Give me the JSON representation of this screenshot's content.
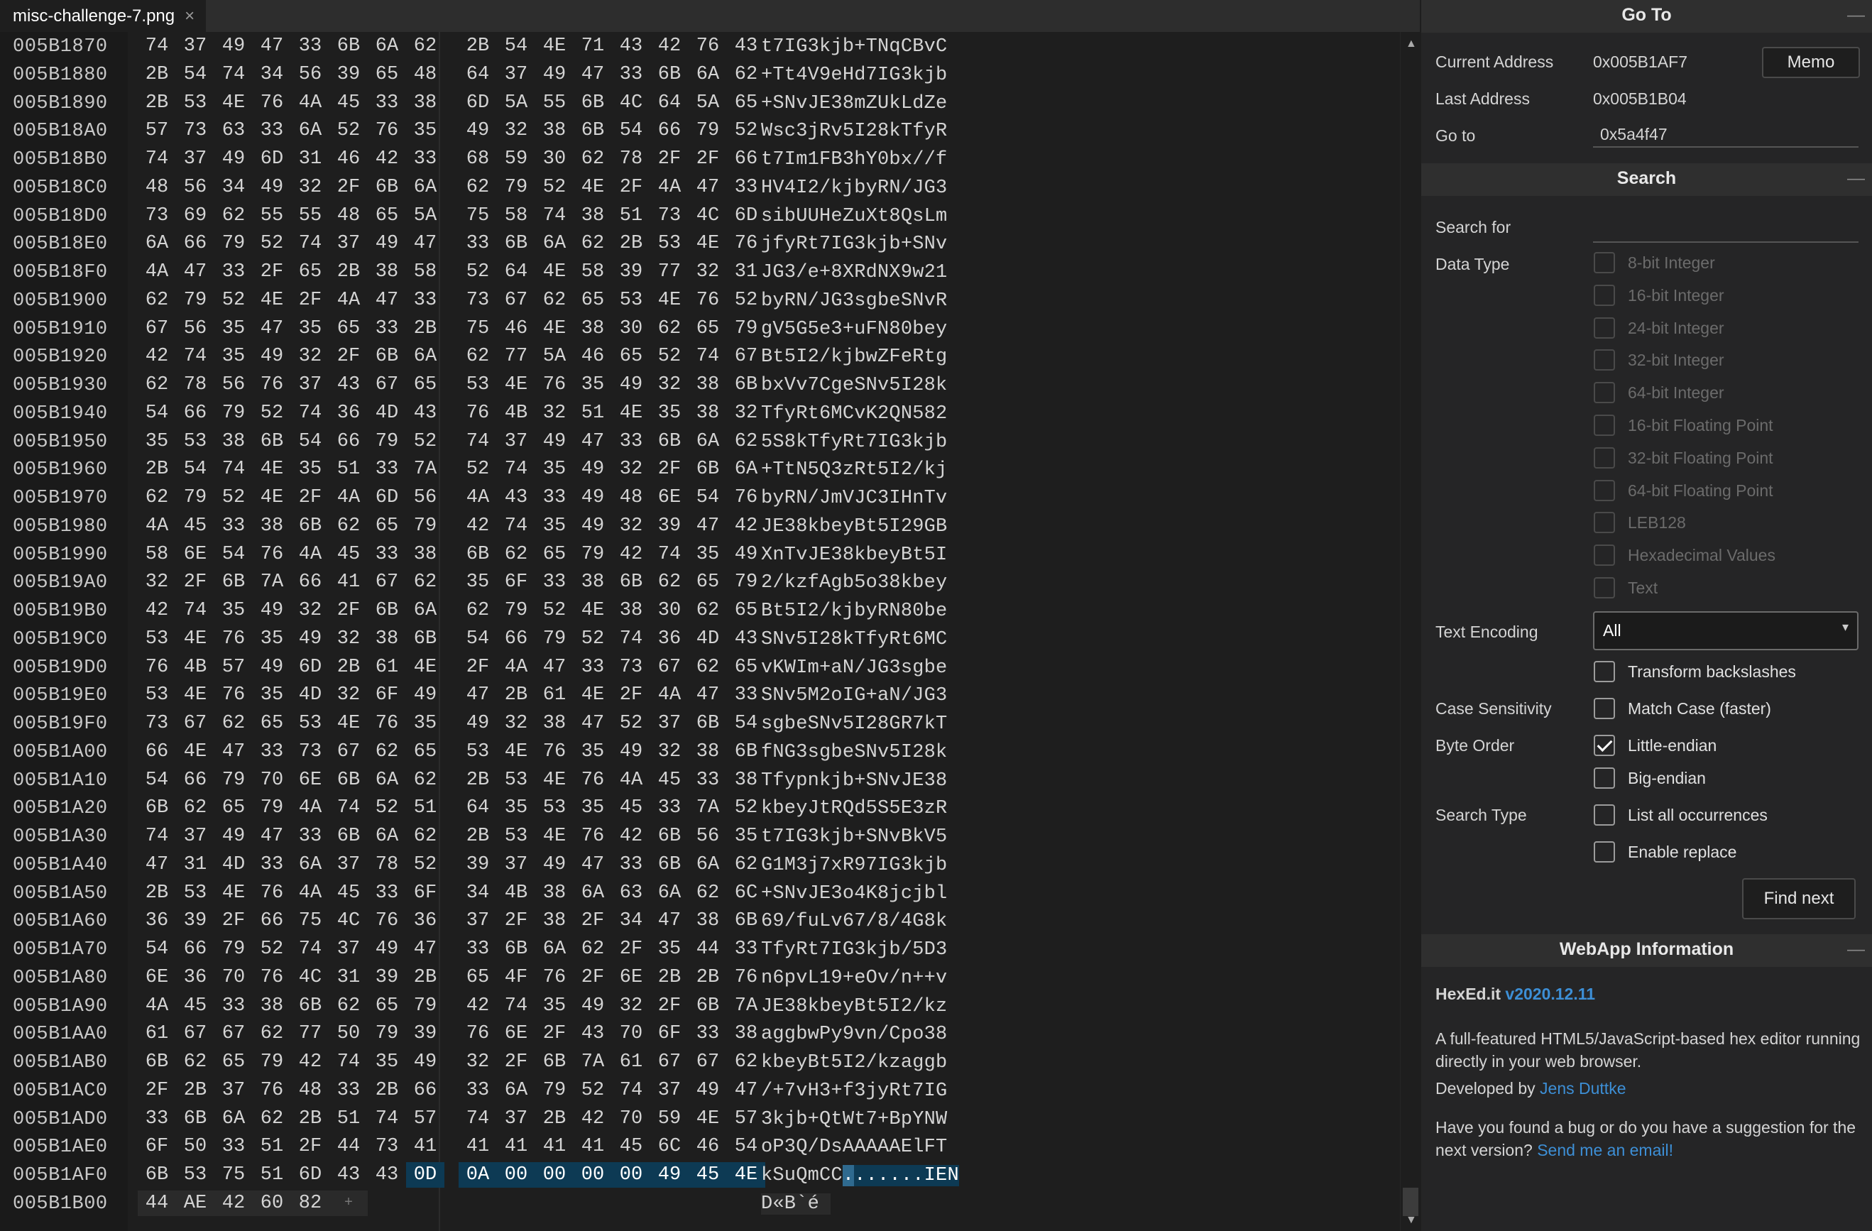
{
  "tab": {
    "title": "misc-challenge-7.png",
    "close": "×"
  },
  "editor": {
    "rows": [
      {
        "offset": "005B1870",
        "bytes": [
          "74",
          "37",
          "49",
          "47",
          "33",
          "6B",
          "6A",
          "62",
          "2B",
          "54",
          "4E",
          "71",
          "43",
          "42",
          "76",
          "43"
        ],
        "ascii": "t7IG3kjb+TNqCBvC"
      },
      {
        "offset": "005B1880",
        "bytes": [
          "2B",
          "54",
          "74",
          "34",
          "56",
          "39",
          "65",
          "48",
          "64",
          "37",
          "49",
          "47",
          "33",
          "6B",
          "6A",
          "62"
        ],
        "ascii": "+Tt4V9eHd7IG3kjb"
      },
      {
        "offset": "005B1890",
        "bytes": [
          "2B",
          "53",
          "4E",
          "76",
          "4A",
          "45",
          "33",
          "38",
          "6D",
          "5A",
          "55",
          "6B",
          "4C",
          "64",
          "5A",
          "65"
        ],
        "ascii": "+SNvJE38mZUkLdZe"
      },
      {
        "offset": "005B18A0",
        "bytes": [
          "57",
          "73",
          "63",
          "33",
          "6A",
          "52",
          "76",
          "35",
          "49",
          "32",
          "38",
          "6B",
          "54",
          "66",
          "79",
          "52"
        ],
        "ascii": "Wsc3jRv5I28kTfyR"
      },
      {
        "offset": "005B18B0",
        "bytes": [
          "74",
          "37",
          "49",
          "6D",
          "31",
          "46",
          "42",
          "33",
          "68",
          "59",
          "30",
          "62",
          "78",
          "2F",
          "2F",
          "66"
        ],
        "ascii": "t7Im1FB3hY0bx//f"
      },
      {
        "offset": "005B18C0",
        "bytes": [
          "48",
          "56",
          "34",
          "49",
          "32",
          "2F",
          "6B",
          "6A",
          "62",
          "79",
          "52",
          "4E",
          "2F",
          "4A",
          "47",
          "33"
        ],
        "ascii": "HV4I2/kjbyRN/JG3"
      },
      {
        "offset": "005B18D0",
        "bytes": [
          "73",
          "69",
          "62",
          "55",
          "55",
          "48",
          "65",
          "5A",
          "75",
          "58",
          "74",
          "38",
          "51",
          "73",
          "4C",
          "6D"
        ],
        "ascii": "sibUUHeZuXt8QsLm"
      },
      {
        "offset": "005B18E0",
        "bytes": [
          "6A",
          "66",
          "79",
          "52",
          "74",
          "37",
          "49",
          "47",
          "33",
          "6B",
          "6A",
          "62",
          "2B",
          "53",
          "4E",
          "76"
        ],
        "ascii": "jfyRt7IG3kjb+SNv"
      },
      {
        "offset": "005B18F0",
        "bytes": [
          "4A",
          "47",
          "33",
          "2F",
          "65",
          "2B",
          "38",
          "58",
          "52",
          "64",
          "4E",
          "58",
          "39",
          "77",
          "32",
          "31"
        ],
        "ascii": "JG3/e+8XRdNX9w21"
      },
      {
        "offset": "005B1900",
        "bytes": [
          "62",
          "79",
          "52",
          "4E",
          "2F",
          "4A",
          "47",
          "33",
          "73",
          "67",
          "62",
          "65",
          "53",
          "4E",
          "76",
          "52"
        ],
        "ascii": "byRN/JG3sgbeSNvR"
      },
      {
        "offset": "005B1910",
        "bytes": [
          "67",
          "56",
          "35",
          "47",
          "35",
          "65",
          "33",
          "2B",
          "75",
          "46",
          "4E",
          "38",
          "30",
          "62",
          "65",
          "79"
        ],
        "ascii": "gV5G5e3+uFN80bey"
      },
      {
        "offset": "005B1920",
        "bytes": [
          "42",
          "74",
          "35",
          "49",
          "32",
          "2F",
          "6B",
          "6A",
          "62",
          "77",
          "5A",
          "46",
          "65",
          "52",
          "74",
          "67"
        ],
        "ascii": "Bt5I2/kjbwZFeRtg"
      },
      {
        "offset": "005B1930",
        "bytes": [
          "62",
          "78",
          "56",
          "76",
          "37",
          "43",
          "67",
          "65",
          "53",
          "4E",
          "76",
          "35",
          "49",
          "32",
          "38",
          "6B"
        ],
        "ascii": "bxVv7CgeSNv5I28k"
      },
      {
        "offset": "005B1940",
        "bytes": [
          "54",
          "66",
          "79",
          "52",
          "74",
          "36",
          "4D",
          "43",
          "76",
          "4B",
          "32",
          "51",
          "4E",
          "35",
          "38",
          "32"
        ],
        "ascii": "TfyRt6MCvK2QN582"
      },
      {
        "offset": "005B1950",
        "bytes": [
          "35",
          "53",
          "38",
          "6B",
          "54",
          "66",
          "79",
          "52",
          "74",
          "37",
          "49",
          "47",
          "33",
          "6B",
          "6A",
          "62"
        ],
        "ascii": "5S8kTfyRt7IG3kjb"
      },
      {
        "offset": "005B1960",
        "bytes": [
          "2B",
          "54",
          "74",
          "4E",
          "35",
          "51",
          "33",
          "7A",
          "52",
          "74",
          "35",
          "49",
          "32",
          "2F",
          "6B",
          "6A"
        ],
        "ascii": "+TtN5Q3zRt5I2/kj"
      },
      {
        "offset": "005B1970",
        "bytes": [
          "62",
          "79",
          "52",
          "4E",
          "2F",
          "4A",
          "6D",
          "56",
          "4A",
          "43",
          "33",
          "49",
          "48",
          "6E",
          "54",
          "76"
        ],
        "ascii": "byRN/JmVJC3IHnTv"
      },
      {
        "offset": "005B1980",
        "bytes": [
          "4A",
          "45",
          "33",
          "38",
          "6B",
          "62",
          "65",
          "79",
          "42",
          "74",
          "35",
          "49",
          "32",
          "39",
          "47",
          "42"
        ],
        "ascii": "JE38kbeyBt5I29GB"
      },
      {
        "offset": "005B1990",
        "bytes": [
          "58",
          "6E",
          "54",
          "76",
          "4A",
          "45",
          "33",
          "38",
          "6B",
          "62",
          "65",
          "79",
          "42",
          "74",
          "35",
          "49"
        ],
        "ascii": "XnTvJE38kbeyBt5I"
      },
      {
        "offset": "005B19A0",
        "bytes": [
          "32",
          "2F",
          "6B",
          "7A",
          "66",
          "41",
          "67",
          "62",
          "35",
          "6F",
          "33",
          "38",
          "6B",
          "62",
          "65",
          "79"
        ],
        "ascii": "2/kzfAgb5o38kbey"
      },
      {
        "offset": "005B19B0",
        "bytes": [
          "42",
          "74",
          "35",
          "49",
          "32",
          "2F",
          "6B",
          "6A",
          "62",
          "79",
          "52",
          "4E",
          "38",
          "30",
          "62",
          "65"
        ],
        "ascii": "Bt5I2/kjbyRN80be"
      },
      {
        "offset": "005B19C0",
        "bytes": [
          "53",
          "4E",
          "76",
          "35",
          "49",
          "32",
          "38",
          "6B",
          "54",
          "66",
          "79",
          "52",
          "74",
          "36",
          "4D",
          "43"
        ],
        "ascii": "SNv5I28kTfyRt6MC"
      },
      {
        "offset": "005B19D0",
        "bytes": [
          "76",
          "4B",
          "57",
          "49",
          "6D",
          "2B",
          "61",
          "4E",
          "2F",
          "4A",
          "47",
          "33",
          "73",
          "67",
          "62",
          "65"
        ],
        "ascii": "vKWIm+aN/JG3sgbe"
      },
      {
        "offset": "005B19E0",
        "bytes": [
          "53",
          "4E",
          "76",
          "35",
          "4D",
          "32",
          "6F",
          "49",
          "47",
          "2B",
          "61",
          "4E",
          "2F",
          "4A",
          "47",
          "33"
        ],
        "ascii": "SNv5M2oIG+aN/JG3"
      },
      {
        "offset": "005B19F0",
        "bytes": [
          "73",
          "67",
          "62",
          "65",
          "53",
          "4E",
          "76",
          "35",
          "49",
          "32",
          "38",
          "47",
          "52",
          "37",
          "6B",
          "54"
        ],
        "ascii": "sgbeSNv5I28GR7kT"
      },
      {
        "offset": "005B1A00",
        "bytes": [
          "66",
          "4E",
          "47",
          "33",
          "73",
          "67",
          "62",
          "65",
          "53",
          "4E",
          "76",
          "35",
          "49",
          "32",
          "38",
          "6B"
        ],
        "ascii": "fNG3sgbeSNv5I28k"
      },
      {
        "offset": "005B1A10",
        "bytes": [
          "54",
          "66",
          "79",
          "70",
          "6E",
          "6B",
          "6A",
          "62",
          "2B",
          "53",
          "4E",
          "76",
          "4A",
          "45",
          "33",
          "38"
        ],
        "ascii": "Tfypnkjb+SNvJE38"
      },
      {
        "offset": "005B1A20",
        "bytes": [
          "6B",
          "62",
          "65",
          "79",
          "4A",
          "74",
          "52",
          "51",
          "64",
          "35",
          "53",
          "35",
          "45",
          "33",
          "7A",
          "52"
        ],
        "ascii": "kbeyJtRQd5S5E3zR"
      },
      {
        "offset": "005B1A30",
        "bytes": [
          "74",
          "37",
          "49",
          "47",
          "33",
          "6B",
          "6A",
          "62",
          "2B",
          "53",
          "4E",
          "76",
          "42",
          "6B",
          "56",
          "35"
        ],
        "ascii": "t7IG3kjb+SNvBkV5"
      },
      {
        "offset": "005B1A40",
        "bytes": [
          "47",
          "31",
          "4D",
          "33",
          "6A",
          "37",
          "78",
          "52",
          "39",
          "37",
          "49",
          "47",
          "33",
          "6B",
          "6A",
          "62"
        ],
        "ascii": "G1M3j7xR97IG3kjb"
      },
      {
        "offset": "005B1A50",
        "bytes": [
          "2B",
          "53",
          "4E",
          "76",
          "4A",
          "45",
          "33",
          "6F",
          "34",
          "4B",
          "38",
          "6A",
          "63",
          "6A",
          "62",
          "6C"
        ],
        "ascii": "+SNvJE3o4K8jcjbl"
      },
      {
        "offset": "005B1A60",
        "bytes": [
          "36",
          "39",
          "2F",
          "66",
          "75",
          "4C",
          "76",
          "36",
          "37",
          "2F",
          "38",
          "2F",
          "34",
          "47",
          "38",
          "6B"
        ],
        "ascii": "69/fuLv67/8/4G8k"
      },
      {
        "offset": "005B1A70",
        "bytes": [
          "54",
          "66",
          "79",
          "52",
          "74",
          "37",
          "49",
          "47",
          "33",
          "6B",
          "6A",
          "62",
          "2F",
          "35",
          "44",
          "33"
        ],
        "ascii": "TfyRt7IG3kjb/5D3"
      },
      {
        "offset": "005B1A80",
        "bytes": [
          "6E",
          "36",
          "70",
          "76",
          "4C",
          "31",
          "39",
          "2B",
          "65",
          "4F",
          "76",
          "2F",
          "6E",
          "2B",
          "2B",
          "76"
        ],
        "ascii": "n6pvL19+eOv/n++v"
      },
      {
        "offset": "005B1A90",
        "bytes": [
          "4A",
          "45",
          "33",
          "38",
          "6B",
          "62",
          "65",
          "79",
          "42",
          "74",
          "35",
          "49",
          "32",
          "2F",
          "6B",
          "7A"
        ],
        "ascii": "JE38kbeyBt5I2/kz"
      },
      {
        "offset": "005B1AA0",
        "bytes": [
          "61",
          "67",
          "67",
          "62",
          "77",
          "50",
          "79",
          "39",
          "76",
          "6E",
          "2F",
          "43",
          "70",
          "6F",
          "33",
          "38"
        ],
        "ascii": "aggbwPy9vn/Cpo38"
      },
      {
        "offset": "005B1AB0",
        "bytes": [
          "6B",
          "62",
          "65",
          "79",
          "42",
          "74",
          "35",
          "49",
          "32",
          "2F",
          "6B",
          "7A",
          "61",
          "67",
          "67",
          "62"
        ],
        "ascii": "kbeyBt5I2/kzaggb"
      },
      {
        "offset": "005B1AC0",
        "bytes": [
          "2F",
          "2B",
          "37",
          "76",
          "48",
          "33",
          "2B",
          "66",
          "33",
          "6A",
          "79",
          "52",
          "74",
          "37",
          "49",
          "47"
        ],
        "ascii": "/+7vH3+f3jyRt7IG"
      },
      {
        "offset": "005B1AD0",
        "bytes": [
          "33",
          "6B",
          "6A",
          "62",
          "2B",
          "51",
          "74",
          "57",
          "74",
          "37",
          "2B",
          "42",
          "70",
          "59",
          "4E",
          "57"
        ],
        "ascii": "3kjb+QtWt7+BpYNW"
      },
      {
        "offset": "005B1AE0",
        "bytes": [
          "6F",
          "50",
          "33",
          "51",
          "2F",
          "44",
          "73",
          "41",
          "41",
          "41",
          "41",
          "41",
          "45",
          "6C",
          "46",
          "54"
        ],
        "ascii": "oP3Q/DsAAAAAElFT"
      },
      {
        "offset": "005B1AF0",
        "bytes": [
          "6B",
          "53",
          "75",
          "51",
          "6D",
          "43",
          "43",
          "0D",
          "0A",
          "00",
          "00",
          "00",
          "00",
          "49",
          "45",
          "4E"
        ],
        "ascii": "kSuQmCC.......IEN"
      },
      {
        "offset": "005B1B00",
        "bytes": [
          "44",
          "AE",
          "42",
          "60",
          "82"
        ],
        "ascii": "D«B`é",
        "add": "+"
      }
    ]
  },
  "scrollbar": {
    "up": "▲",
    "down": "▼"
  },
  "goto": {
    "heading": "Go To",
    "current_label": "Current Address",
    "current_value": "0x005B1AF7",
    "memo_button": "Memo",
    "last_label": "Last Address",
    "last_value": "0x005B1B04",
    "goto_label": "Go to",
    "goto_value": "0x5a4f47"
  },
  "search": {
    "heading": "Search",
    "search_for_label": "Search for",
    "search_for_value": "",
    "data_type_label": "Data Type",
    "data_types": [
      "8-bit Integer",
      "16-bit Integer",
      "24-bit Integer",
      "32-bit Integer",
      "64-bit Integer",
      "16-bit Floating Point",
      "32-bit Floating Point",
      "64-bit Floating Point",
      "LEB128",
      "Hexadecimal Values",
      "Text"
    ],
    "text_encoding_label": "Text Encoding",
    "text_encoding_value": "All",
    "transform_label": "Transform backslashes",
    "case_label": "Case Sensitivity",
    "match_case_label": "Match Case (faster)",
    "byte_order_label": "Byte Order",
    "little_endian_label": "Little-endian",
    "big_endian_label": "Big-endian",
    "search_type_label": "Search Type",
    "list_all_label": "List all occurrences",
    "enable_replace_label": "Enable replace",
    "find_next_button": "Find next"
  },
  "webapp": {
    "heading": "WebApp Information",
    "app_name": "HexEd.it",
    "version": "v2020.12.11",
    "desc": "A full-featured HTML5/JavaScript-based hex editor running directly in your web browser.",
    "dev_prefix": "Developed by",
    "dev_name": "Jens Duttke",
    "bug_text": "Have you found a bug or do you have a suggestion for the next version?",
    "email_link": "Send me an email!"
  },
  "colors": {
    "selection": "#0d3a54",
    "link": "#3d8fd6",
    "panel_bg": "#252526",
    "editor_bg": "#1e1e1e"
  }
}
